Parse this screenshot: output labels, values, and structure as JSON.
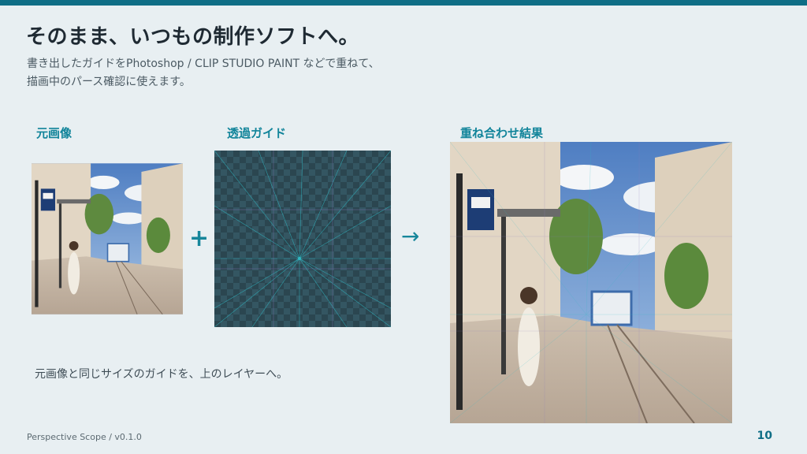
{
  "slide": {
    "title": "そのまま、いつもの制作ソフトへ。",
    "subtitle_line1": "書き出したガイドをPhotoshop / CLIP STUDIO PAINT などで重ねて、",
    "subtitle_line2": "描画中のパース確認に使えます。",
    "labels": {
      "source": "元画像",
      "guide": "透過ガイド",
      "result": "重ね合わせ結果"
    },
    "operators": {
      "plus": "+",
      "arrow": "→"
    },
    "caption": "元画像と同じサイズのガイドを、上のレイヤーへ。",
    "footer": "Perspective Scope  /  v0.1.0",
    "page_number": "10"
  },
  "colors": {
    "accent": "#0f6e86",
    "label": "#11849a",
    "background": "#e8eff2",
    "guide_dark": "#2b4650",
    "guide_light": "#345662",
    "guide_line": "#2fb9c4"
  },
  "icons": {
    "bus_sign": "bus-sign-icon"
  }
}
